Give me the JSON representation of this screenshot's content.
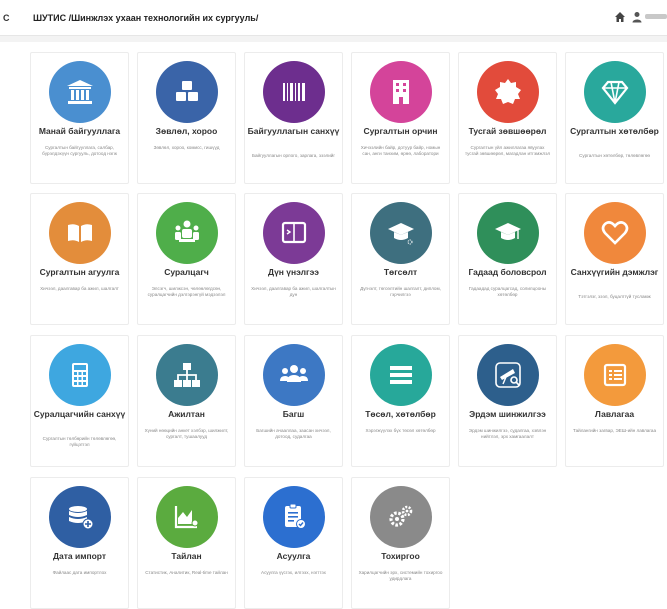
{
  "header": {
    "left_letter": "С",
    "title": "ШУТИС /Шинжлэх ухаан технологийн их сургууль/"
  },
  "tiles": [
    {
      "title": "Манай байгууллага",
      "desc": "Сургалтын байгууллага, салбар, бүрэлдэхүүн сургууль, дотоод нэгж",
      "color": "#4a8fd0",
      "icon": "institution-icon"
    },
    {
      "title": "Зөвлөл, хороо",
      "desc": "Зөвлөл, хороо, комисс, гишүүд",
      "color": "#3a64a8",
      "icon": "cubes-icon"
    },
    {
      "title": "Байгууллагын санхүү",
      "desc": "Байгууллагын орлого, зарлага, зээлийг",
      "color": "#6d2e8e",
      "icon": "barcode-icon"
    },
    {
      "title": "Сургалтын орчин",
      "desc": "Хичээлийн байр, дотуур байр, номын сан, анги танхим, өрөө, лаборатори",
      "color": "#d4449a",
      "icon": "building-icon"
    },
    {
      "title": "Тусгай зөвшөөрөл",
      "desc": "Сургалтын үйл ажиллагаа явуулах тусгай зөвшөөрөл, магадлан итгэмжлэл",
      "color": "#e24b3b",
      "icon": "badge-icon"
    },
    {
      "title": "Сургалтын хөтөлбөр",
      "desc": "Сургалтын хөтөлбөр, төлөвлөгөө",
      "color": "#29a89c",
      "icon": "diamond-icon"
    },
    {
      "title": "Сургалтын агуулга",
      "desc": "Хичээл, даалгавар ба ажил, шалгалт",
      "color": "#e38d3b",
      "icon": "book-open-icon"
    },
    {
      "title": "Суралцагч",
      "desc": "Элсэгч, шилжсэн, чөлөөлөгдсөн, суралцагчийн дэлгэрэнгүй мэдээлэл",
      "color": "#4fae4a",
      "icon": "students-icon"
    },
    {
      "title": "Дүн үнэлгээ",
      "desc": "Хичээл, даалгавар ба ажил, шалгалтын дүн",
      "color": "#7c3a96",
      "icon": "gradebook-icon"
    },
    {
      "title": "Төгсөлт",
      "desc": "Дүгнэлт, төгсөлтийн шалгалт, диплом, гэрчилгээ",
      "color": "#3e6f7f",
      "icon": "graduation-cap-icon"
    },
    {
      "title": "Гадаад боловсрол",
      "desc": "Гадаадад суралцагсад, солилцооны хөтөлбөр",
      "color": "#2f8f5a",
      "icon": "mortarboard-icon"
    },
    {
      "title": "Санхүүгийн дэмжлэг",
      "desc": "Тэтгэлэг, зээл, буцалтгүй тусламж",
      "color": "#f0883c",
      "icon": "heart-icon"
    },
    {
      "title": "Суралцагчийн санхүү",
      "desc": "Сургалтын төлбөрийн төлөвлөгөө, гүйцэтгэл",
      "color": "#3ea7e0",
      "icon": "calculator-icon"
    },
    {
      "title": "Ажилтан",
      "desc": "Хүний нөөцийн анкет хэлбэр, шилжилт, сургалт, тушаалууд",
      "color": "#3b7c8f",
      "icon": "org-chart-icon"
    },
    {
      "title": "Багш",
      "desc": "Багшийн ачааллаа, заасан хичээл, дотоод, судалгаа",
      "color": "#3d78c4",
      "icon": "users-icon"
    },
    {
      "title": "Төсөл, хөтөлбөр",
      "desc": "Хэрэгжүүлэх бүх төсөл хөтөлбөр",
      "color": "#27a89a",
      "icon": "list-icon"
    },
    {
      "title": "Эрдэм шинжилгээ",
      "desc": "Эрдэм шинжилгээ, судалгаа, хэвлэн нийтлэл, эрх хамгаалалт",
      "color": "#2d5f8c",
      "icon": "telescope-icon"
    },
    {
      "title": "Лавлагаа",
      "desc": "Тайлангийн загвар, ЭЕШ-ийн лавлагаа",
      "color": "#f39a3c",
      "icon": "reference-icon"
    },
    {
      "title": "Дата импорт",
      "desc": "Файлаас дата импортлох",
      "color": "#2f5fa3",
      "icon": "database-icon"
    },
    {
      "title": "Тайлан",
      "desc": "Статистик, Аналитик, Real-time тайлан",
      "color": "#5bab3f",
      "icon": "chart-icon"
    },
    {
      "title": "Асуулга",
      "desc": "Асуулга үүсгэх, илгээх, нэгтгэх",
      "color": "#2c6fd0",
      "icon": "survey-icon"
    },
    {
      "title": "Тохиргоо",
      "desc": "Харилцагчийн эрх, системийн тохиргоо удирдлага",
      "color": "#8a8a8a",
      "icon": "gears-icon"
    }
  ]
}
